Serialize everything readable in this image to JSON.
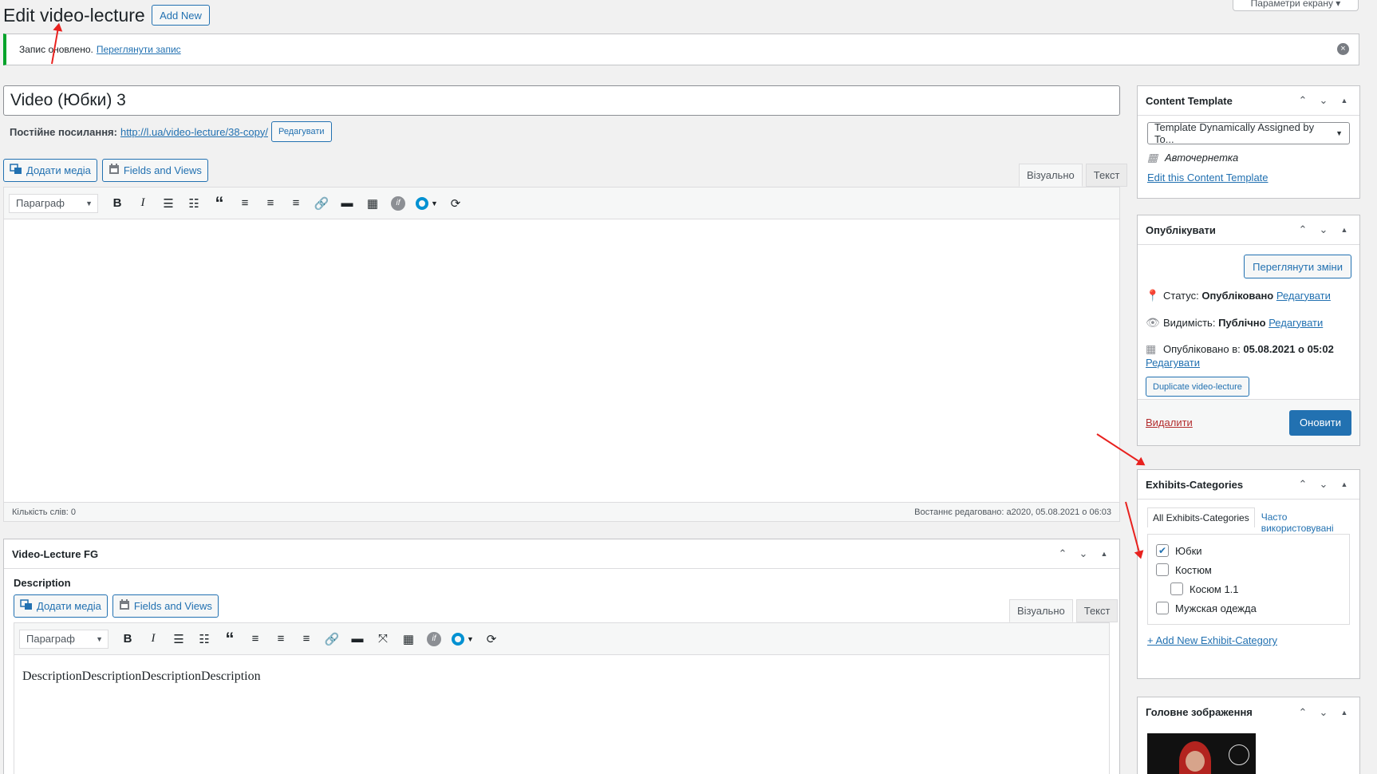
{
  "header": {
    "title": "Edit video-lecture",
    "add_new": "Add New",
    "screen_options": "Параметри екрану ▾"
  },
  "notice": {
    "text": "Запис оновлено.",
    "link": "Переглянути запис"
  },
  "post": {
    "title": "Video  (Юбки)  3",
    "permalink_label": "Постійне посилання:",
    "permalink_url": "http://l.ua/video-lecture/38-copy/",
    "edit_button": "Редагувати"
  },
  "editor": {
    "add_media": "Додати медіа",
    "fields_views": "Fields and Views",
    "tab_visual": "Візуально",
    "tab_text": "Текст",
    "format": "Параграф",
    "word_count": "Кількість слів: 0",
    "last_edited": "Востаннє редаговано: a2020, 05.08.2021 о 06:03"
  },
  "video_lecture_box": {
    "title": "Video-Lecture FG",
    "description_label": "Description",
    "add_media": "Додати медіа",
    "fields_views": "Fields and Views",
    "tab_visual": "Візуально",
    "tab_text": "Текст",
    "format": "Параграф",
    "content": "DescriptionDescriptionDescriptionDescription"
  },
  "content_template": {
    "title": "Content Template",
    "selected": "Template Dynamically Assigned by To...",
    "draft_label": "Авточернетка",
    "edit_link": "Edit this Content Template"
  },
  "publish": {
    "title": "Опублікувати",
    "preview_button": "Переглянути зміни",
    "status_label": "Статус:",
    "status_value": "Опубліковано",
    "visibility_label": "Видимість:",
    "visibility_value": "Публічно",
    "published_label": "Опубліковано в:",
    "published_value": "05.08.2021 о 05:02",
    "edit_link": "Редагувати",
    "duplicate_button": "Duplicate video-lecture",
    "delete_link": "Видалити",
    "update_button": "Оновити"
  },
  "exhibits_categories": {
    "title": "Exhibits-Categories",
    "tab_all": "All Exhibits-Categories",
    "tab_popular": "Часто використовувані",
    "items": [
      {
        "label": "Юбки",
        "checked": true,
        "indent": 0
      },
      {
        "label": "Костюм",
        "checked": false,
        "indent": 0
      },
      {
        "label": "Косюм 1.1",
        "checked": false,
        "indent": 1
      },
      {
        "label": "Мужская одежда",
        "checked": false,
        "indent": 0
      }
    ],
    "add_new": "+ Add New Exhibit-Category"
  },
  "featured_image": {
    "title": "Головне зображення"
  },
  "colors": {
    "accent": "#2271b1",
    "success": "#00a32a",
    "danger": "#b32d2e",
    "annotation": "#e8211e"
  }
}
